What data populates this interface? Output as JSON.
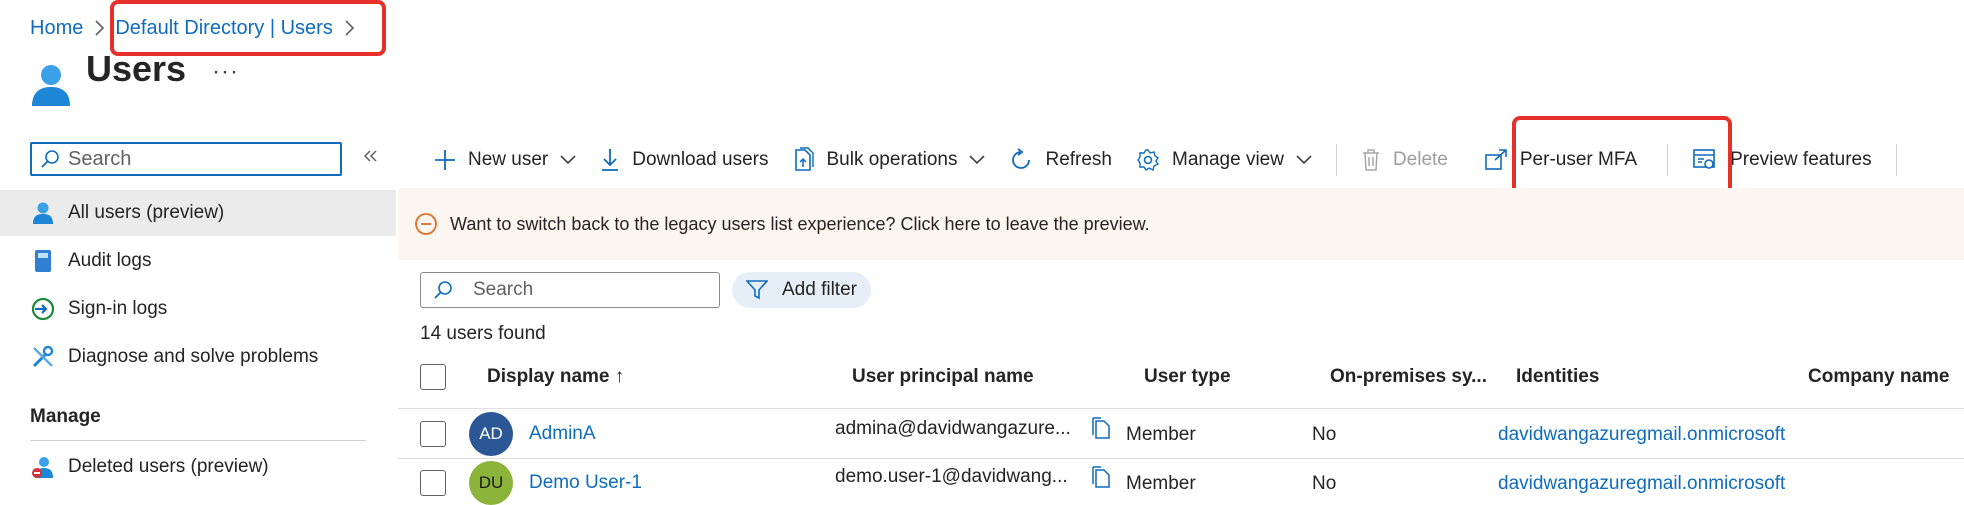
{
  "breadcrumb": {
    "home": "Home",
    "directory": "Default Directory | Users"
  },
  "page": {
    "title": "Users",
    "more": "···"
  },
  "nav": {
    "search_placeholder": "Search",
    "items": [
      {
        "label": "All users (preview)",
        "icon": "user-icon"
      },
      {
        "label": "Audit logs",
        "icon": "book-icon"
      },
      {
        "label": "Sign-in logs",
        "icon": "sign-in-icon"
      },
      {
        "label": "Diagnose and solve problems",
        "icon": "wrench-icon"
      }
    ],
    "manage_header": "Manage",
    "manage_items": [
      {
        "label": "Deleted users (preview)",
        "icon": "deleted-user-icon"
      }
    ]
  },
  "toolbar": {
    "new_user": "New user",
    "download_users": "Download users",
    "bulk_operations": "Bulk operations",
    "refresh": "Refresh",
    "manage_view": "Manage view",
    "delete": "Delete",
    "per_user_mfa": "Per-user MFA",
    "preview_features": "Preview features"
  },
  "banner": {
    "text": "Want to switch back to the legacy users list experience? Click here to leave the preview."
  },
  "list": {
    "search_placeholder": "Search",
    "add_filter": "Add filter",
    "count_text": "14 users found",
    "columns": {
      "display_name": "Display name ↑",
      "upn": "User principal name",
      "user_type": "User type",
      "on_prem": "On-premises sy...",
      "identities": "Identities",
      "company": "Company name"
    },
    "rows": [
      {
        "initials": "AD",
        "avatar_color": "#2b5797",
        "avatar_text_color": "#ffffff",
        "display_name": "AdminA",
        "upn": "admina@davidwangazure...",
        "user_type": "Member",
        "on_prem": "No",
        "identity": "davidwangazuregmail.onmicrosoft"
      },
      {
        "initials": "DU",
        "avatar_color": "#8cb33a",
        "avatar_text_color": "#1a1a1a",
        "display_name": "Demo User-1",
        "upn": "demo.user-1@davidwang...",
        "user_type": "Member",
        "on_prem": "No",
        "identity": "davidwangazuregmail.onmicrosoft"
      }
    ]
  },
  "colors": {
    "accent": "#0f6cbd",
    "highlight_box": "#e8302a",
    "banner_bg": "#fdf5ef",
    "banner_icon": "#d9712b"
  }
}
